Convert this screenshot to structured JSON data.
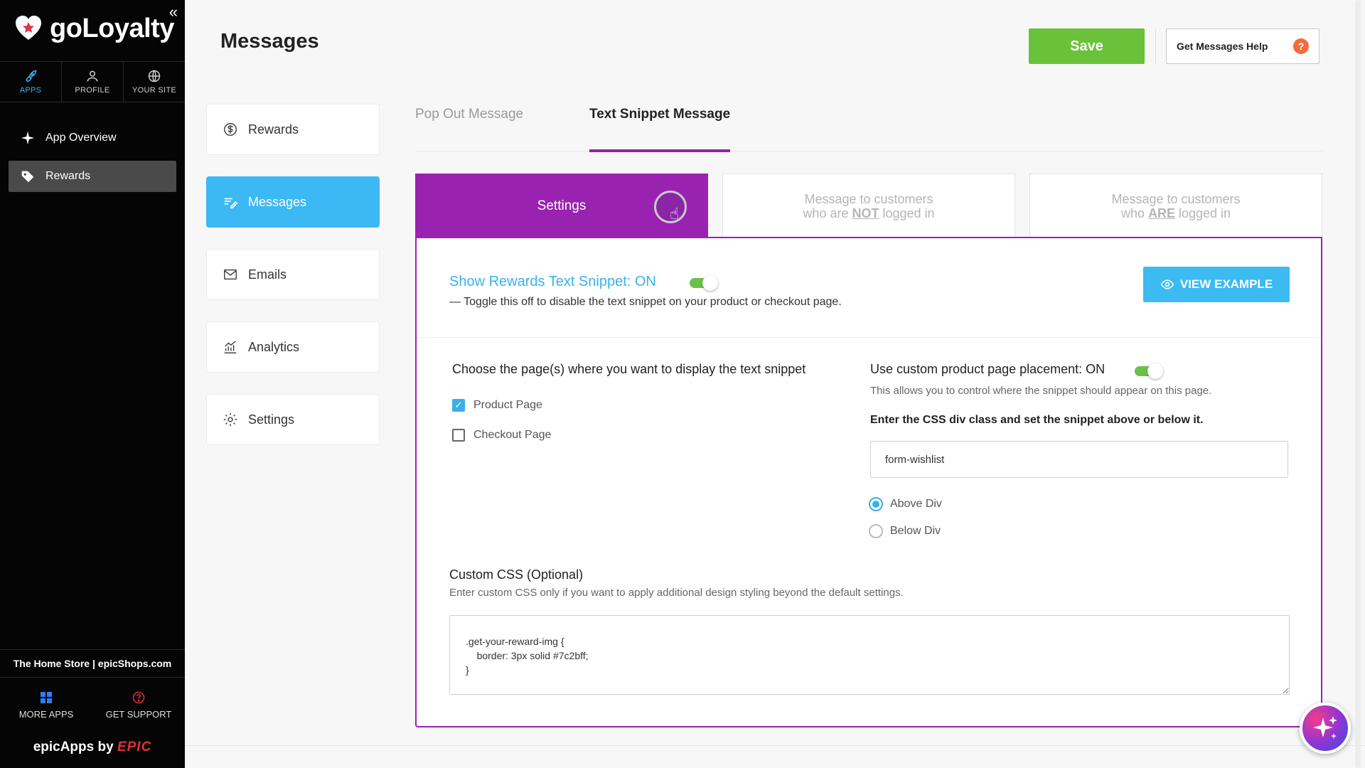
{
  "brand": {
    "logo_text": "goLoyalty",
    "collapse_icon": "«"
  },
  "topnav": [
    {
      "label": "APPS",
      "icon": "rocket-icon"
    },
    {
      "label": "PROFILE",
      "icon": "user-icon"
    },
    {
      "label": "YOUR SITE",
      "icon": "globe-icon"
    }
  ],
  "side_menu": [
    {
      "label": "App Overview",
      "icon": "sparkle-icon"
    },
    {
      "label": "Rewards",
      "icon": "tag-icon"
    }
  ],
  "store_line": "The Home Store | epicShops.com",
  "bottom_nav": [
    {
      "label": "MORE APPS",
      "icon": "grid-icon"
    },
    {
      "label": "GET SUPPORT",
      "icon": "help-circle-icon"
    }
  ],
  "footer_brand": {
    "prefix": "epicApps by",
    "brand": "EPIC"
  },
  "header": {
    "title": "Messages",
    "save_label": "Save",
    "help_label": "Get Messages Help",
    "help_icon": "?"
  },
  "sections": [
    {
      "label": "Rewards",
      "icon": "dollar-circle-icon"
    },
    {
      "label": "Messages",
      "icon": "message-lines-icon"
    },
    {
      "label": "Emails",
      "icon": "envelope-icon"
    },
    {
      "label": "Analytics",
      "icon": "chart-icon"
    },
    {
      "label": "Settings",
      "icon": "gear-icon"
    }
  ],
  "tabs": [
    {
      "label": "Pop Out Message"
    },
    {
      "label": "Text Snippet Message"
    }
  ],
  "subtabs": {
    "settings": "Settings",
    "not_logged": {
      "line1": "Message to customers",
      "pre": "who are ",
      "em": "NOT",
      "post": " logged in"
    },
    "logged": {
      "line1": "Message to customers",
      "pre": "who ",
      "em": "ARE",
      "post": " logged in"
    }
  },
  "snippet": {
    "title": "Show Rewards Text Snippet: ON",
    "desc": "— Toggle this off to disable the text snippet on your product or checkout page.",
    "view_example": "VIEW EXAMPLE"
  },
  "pages": {
    "label": "Choose the page(s) where you want to display the text snippet",
    "product": "Product Page",
    "checkout": "Checkout Page"
  },
  "placement": {
    "label": "Use custom product page placement: ON",
    "desc": "This allows you to control where the snippet should appear on this page.",
    "css_label": "Enter the CSS div class and set the snippet above or below it.",
    "css_value": "form-wishlist",
    "above": "Above Div",
    "below": "Below Div"
  },
  "custom_css": {
    "label": "Custom CSS (Optional)",
    "desc": "Enter custom CSS only if you want to apply additional design styling beyond the default settings.",
    "value": ".get-your-reward-img {\n    border: 3px solid #7c2bff;\n}"
  },
  "colors": {
    "accent_purple": "#9a22b0",
    "accent_blue": "#3cb8f4",
    "save_green": "#6ac23a",
    "help_orange": "#f26b3a"
  }
}
